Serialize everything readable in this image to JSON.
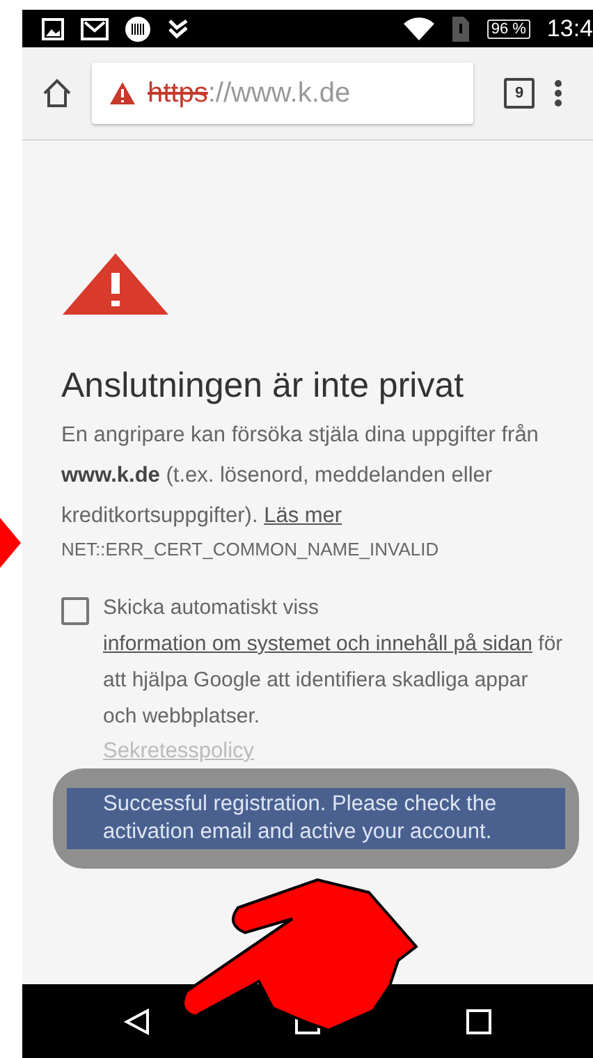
{
  "status_bar": {
    "battery": "96 %",
    "time": "13:4"
  },
  "toolbar": {
    "url_scheme": "https",
    "url_rest": "://www.k.de",
    "tab_count": "9"
  },
  "page": {
    "heading": "Anslutningen är inte privat",
    "body": "En angripare kan försöka stjäla dina uppgifter från **www.k.de** (t.ex. lösenord, meddelanden eller kreditkortsuppgifter).",
    "learn_more": "Läs mer",
    "error_code": "NET::ERR_CERT_COMMON_NAME_INVALID",
    "report": {
      "checked": false,
      "text_before": "Skicka automatiskt viss",
      "link": "information om systemet och innehåll på sidan",
      "text_after": "för att hjälpa Google att identifiera skadliga appar och webbplatser.",
      "privacy_link": "Sekretesspolicy"
    }
  },
  "toast": {
    "message": "Successful registration. Please check the activation email and active your account."
  }
}
